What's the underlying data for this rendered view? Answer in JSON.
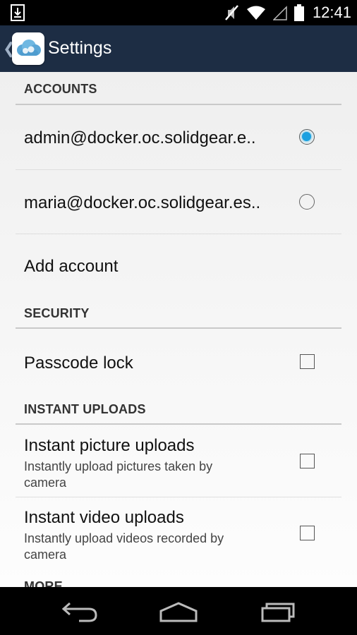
{
  "status_bar": {
    "time": "12:41",
    "icons": [
      "download-notification-icon",
      "mute-icon",
      "wifi-icon",
      "signal-icon",
      "battery-icon"
    ]
  },
  "action_bar": {
    "title": "Settings",
    "icon": "owncloud-app-icon"
  },
  "sections": {
    "accounts": {
      "header": "ACCOUNTS",
      "items": [
        {
          "label": "admin@docker.oc.solidgear.e..",
          "selected": true
        },
        {
          "label": "maria@docker.oc.solidgear.es..",
          "selected": false
        }
      ],
      "add_label": "Add account"
    },
    "security": {
      "header": "SECURITY",
      "passcode_label": "Passcode lock",
      "passcode_checked": false
    },
    "instant_uploads": {
      "header": "INSTANT UPLOADS",
      "pictures": {
        "title": "Instant picture uploads",
        "summary": "Instantly upload pictures taken by camera",
        "checked": false
      },
      "videos": {
        "title": "Instant video uploads",
        "summary": "Instantly upload videos recorded by camera",
        "checked": false
      }
    },
    "more": {
      "header": "MORE"
    }
  },
  "nav_bar": {
    "buttons": [
      "back-icon",
      "home-icon",
      "recent-apps-icon"
    ]
  },
  "colors": {
    "action_bar": "#1d2d44",
    "radio_accent": "#1aa0e0",
    "background": "#efefef"
  }
}
